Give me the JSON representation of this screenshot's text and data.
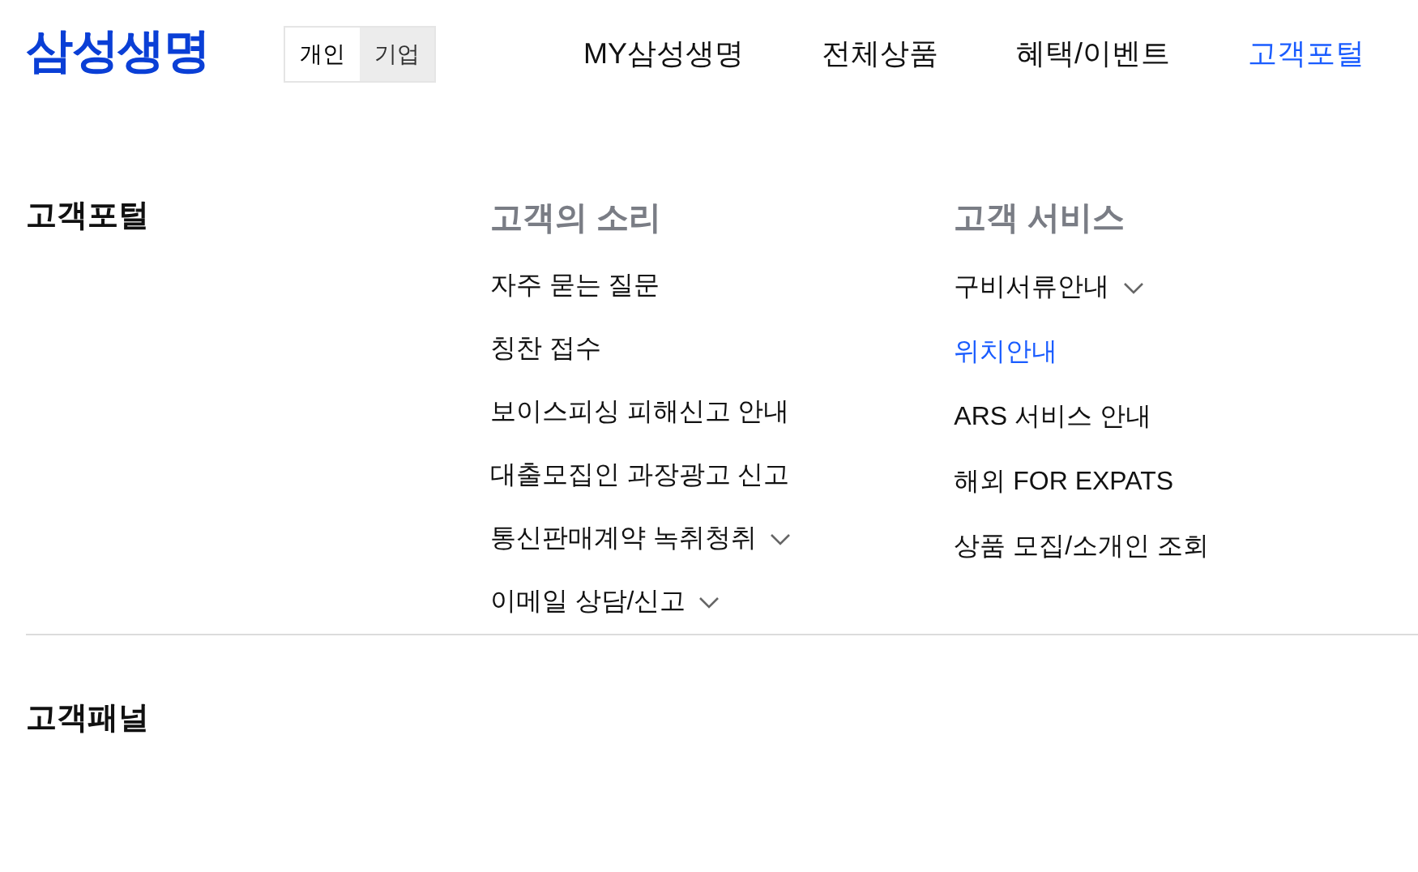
{
  "logo": "삼성생명",
  "segment": [
    {
      "label": "개인",
      "selected": true
    },
    {
      "label": "기업",
      "selected": false
    }
  ],
  "nav": [
    {
      "label": "MY삼성생명",
      "selected": false
    },
    {
      "label": "전체상품",
      "selected": false
    },
    {
      "label": "혜택/이벤트",
      "selected": false
    },
    {
      "label": "고객포털",
      "selected": true
    }
  ],
  "section": {
    "title": "고객포털",
    "columns": [
      {
        "heading": "고객의 소리",
        "items": [
          {
            "label": "자주 묻는 질문",
            "selected": false,
            "expandable": false
          },
          {
            "label": "칭찬 접수",
            "selected": false,
            "expandable": false
          },
          {
            "label": "보이스피싱 피해신고 안내",
            "selected": false,
            "expandable": false
          },
          {
            "label": "대출모집인 과장광고 신고",
            "selected": false,
            "expandable": false
          },
          {
            "label": "통신판매계약 녹취청취",
            "selected": false,
            "expandable": true
          },
          {
            "label": "이메일 상담/신고",
            "selected": false,
            "expandable": true
          }
        ]
      },
      {
        "heading": "고객 서비스",
        "items": [
          {
            "label": "구비서류안내",
            "selected": false,
            "expandable": true
          },
          {
            "label": "위치안내",
            "selected": true,
            "expandable": false
          },
          {
            "label": "ARS 서비스 안내",
            "selected": false,
            "expandable": false
          },
          {
            "label": "해외 FOR EXPATS",
            "selected": false,
            "expandable": false
          },
          {
            "label": "상품 모집/소개인 조회",
            "selected": false,
            "expandable": false
          }
        ]
      }
    ]
  },
  "next_section": {
    "title": "고객패널"
  }
}
